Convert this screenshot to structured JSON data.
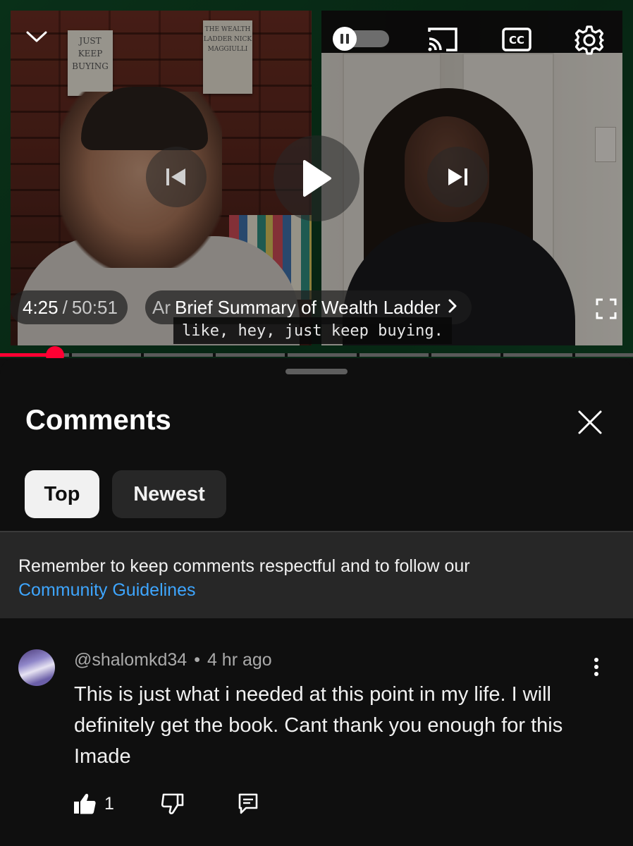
{
  "player": {
    "books": {
      "left": "JUST KEEP BUYING",
      "right": "THE WEALTH LADDER NICK MAGGIULLI"
    },
    "time_current": "4:25",
    "time_separator": "/",
    "time_total": "50:51",
    "chapter_prefix": "Ar",
    "chapter_title": "Brief Summary of Wealth Ladder",
    "caption": "like, hey, just keep buying.",
    "icons": {
      "collapse": "chevron-down-icon",
      "autoplay": "autoplay-toggle-icon",
      "cast": "cast-icon",
      "captions": "closed-captions-icon",
      "settings": "gear-icon",
      "previous": "skip-previous-icon",
      "play": "play-icon",
      "next": "skip-next-icon",
      "fullscreen": "fullscreen-icon"
    },
    "progress_fraction": 0.087,
    "colors": {
      "progress": "#ff0033",
      "background": "#0f4a26"
    }
  },
  "comments": {
    "title": "Comments",
    "sort_tabs": [
      {
        "label": "Top",
        "selected": true
      },
      {
        "label": "Newest",
        "selected": false
      }
    ],
    "notice_text": "Remember to keep comments respectful and to follow our",
    "notice_link": "Community Guidelines",
    "items": [
      {
        "author": "@shalomkd34",
        "separator": "•",
        "age": "4 hr ago",
        "text": "This is just what i needed at this point in my life. I will definitely get the book. Cant thank you enough for this Imade",
        "likes": "1"
      }
    ],
    "colors": {
      "link": "#3ea6ff",
      "sheet": "#0f0f0f",
      "chip_selected": "#f1f1f1"
    }
  }
}
